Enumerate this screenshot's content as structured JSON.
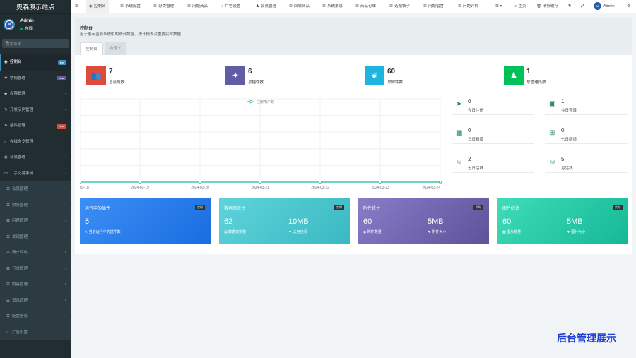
{
  "sidebar": {
    "brand": "奥森演示站点",
    "user_name": "Admin",
    "user_status": "在线",
    "search_placeholder": "搜索菜单",
    "items": [
      {
        "icon": "◉",
        "label": "控制台",
        "badge": "hot",
        "badge_color": "#3c8dbc"
      },
      {
        "icon": "✱",
        "label": "常规管理",
        "badge": "new",
        "badge_color": "#605ca8"
      },
      {
        "icon": "◆",
        "label": "权限管理",
        "arrow": "‹"
      },
      {
        "icon": "✎",
        "label": "开发示例管理",
        "arrow": "‹"
      },
      {
        "icon": "➤",
        "label": "插件管理",
        "badge": "new",
        "badge_color": "#dd4b39"
      },
      {
        "icon": ">_",
        "label": "在线命令管理"
      },
      {
        "icon": "◉",
        "label": "会员管理",
        "arrow": "‹"
      },
      {
        "icon": "▭",
        "label": "二手交易系统",
        "arrow": "⌄"
      }
    ],
    "subitems": [
      {
        "label": "会员管理"
      },
      {
        "label": "财务管理"
      },
      {
        "label": "问题管理"
      },
      {
        "label": "发现管理"
      },
      {
        "label": "商户回收"
      },
      {
        "label": "订单管理"
      },
      {
        "label": "内容管理"
      },
      {
        "label": "消息管理"
      },
      {
        "label": "配置信息"
      },
      {
        "label": "广告设置"
      }
    ]
  },
  "navbar": {
    "items": [
      {
        "icon": "◉",
        "label": "控制台"
      },
      {
        "icon": "☰",
        "label": "系统配置"
      },
      {
        "icon": "☰",
        "label": "分类管理"
      },
      {
        "icon": "☰",
        "label": "问题商品"
      },
      {
        "icon": "○",
        "label": "广告设置"
      },
      {
        "icon": "♟",
        "label": "会员管理"
      },
      {
        "icon": "☰",
        "label": "回收商品"
      },
      {
        "icon": "☰",
        "label": "系统消息"
      },
      {
        "icon": "☰",
        "label": "商品订单"
      },
      {
        "icon": "☰",
        "label": "话题帖子"
      },
      {
        "icon": "☰",
        "label": "问题留言"
      },
      {
        "icon": "☰",
        "label": "问题评价"
      }
    ],
    "home": "主页",
    "clear_cache": "清除缓存",
    "admin": "Admin"
  },
  "panel": {
    "title": "控制台",
    "desc": "用于展示当前系统中的统计数据、统计报表及重要实时数据",
    "tabs": [
      "控制台",
      "自定义"
    ]
  },
  "stats": [
    {
      "value": "7",
      "label": "总会员数",
      "color": "#dd4b39",
      "icon": "👥"
    },
    {
      "value": "6",
      "label": "总插件数",
      "color": "#605ca8",
      "icon": "✦"
    },
    {
      "value": "60",
      "label": "总附件数",
      "color": "#00c0ef",
      "icon": "❦"
    },
    {
      "value": "1",
      "label": "总管理员数",
      "color": "#00a65a",
      "icon": "♟"
    }
  ],
  "mini_stats": [
    {
      "value": "0",
      "label": "今日注册",
      "icon": "➤"
    },
    {
      "value": "1",
      "label": "今日登录",
      "icon": "▣"
    },
    {
      "value": "0",
      "label": "三日新增",
      "icon": "▦"
    },
    {
      "value": "0",
      "label": "七日新增",
      "icon": "⊞"
    },
    {
      "value": "2",
      "label": "七日活跃",
      "icon": "☺"
    },
    {
      "value": "5",
      "label": "月活跃",
      "icon": "☺"
    }
  ],
  "chart_data": {
    "type": "line",
    "categories": [
      "03-18",
      "2024-03-19",
      "2024-03-20",
      "2024-03-21",
      "2024-03-22",
      "2024-03-23",
      "2024-03-24"
    ],
    "series": [
      {
        "name": "注册用户数",
        "values": [
          0,
          0,
          0,
          0,
          0,
          0,
          0
        ]
      }
    ]
  },
  "cards": [
    {
      "title": "运行中的插件",
      "tag": "实时",
      "left_val": "5",
      "left_sub": "当前运行中的插件数",
      "left_sub_icon": "✎",
      "right_val": "",
      "right_sub": "",
      "bg": "linear-gradient(135deg,#3c8ff5,#1a6de0)"
    },
    {
      "title": "数据库统计",
      "tag": "实时",
      "left_val": "62",
      "left_sub": "数据表数量",
      "left_sub_icon": "▤",
      "right_val": "10MB",
      "right_sub": "占用空间",
      "right_sub_icon": "▼",
      "bg": "linear-gradient(135deg,#5fd3da,#3ab9c2)"
    },
    {
      "title": "附件统计",
      "tag": "实时",
      "left_val": "60",
      "left_sub": "附件数量",
      "left_sub_icon": "◉",
      "right_val": "5MB",
      "right_sub": "附件大小",
      "right_sub_icon": "▼",
      "bg": "linear-gradient(135deg,#8a7cc9,#5e5299)"
    },
    {
      "title": "图片统计",
      "tag": "实时",
      "left_val": "60",
      "left_sub": "图片数量",
      "left_sub_icon": "▩",
      "right_val": "5MB",
      "right_sub": "图片大小",
      "right_sub_icon": "▼",
      "bg": "linear-gradient(135deg,#3fdcb8,#15b896)"
    }
  ],
  "watermark": "后台管理展示"
}
